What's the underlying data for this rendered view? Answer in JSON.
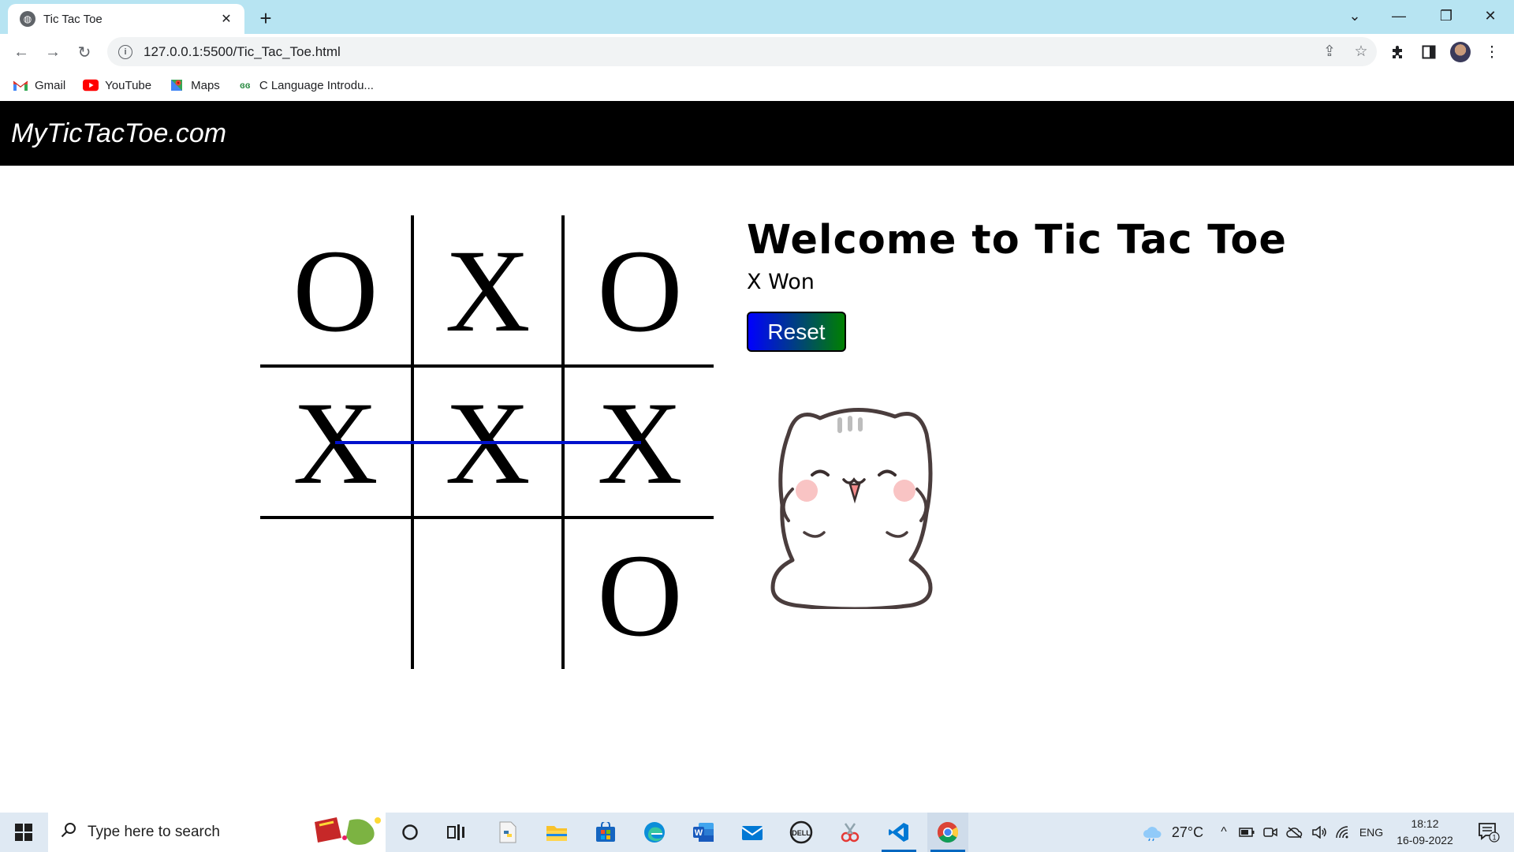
{
  "browser": {
    "tab_title": "Tic Tac Toe",
    "tab_close": "✕",
    "new_tab": "+",
    "url": "127.0.0.1:5500/Tic_Tac_Toe.html",
    "window_controls": {
      "dropdown": "⌄",
      "minimize": "—",
      "restore": "❐",
      "close": "✕"
    },
    "bookmarks": [
      {
        "label": "Gmail",
        "icon": "gmail-icon"
      },
      {
        "label": "YouTube",
        "icon": "youtube-icon"
      },
      {
        "label": "Maps",
        "icon": "maps-icon"
      },
      {
        "label": "C Language Introdu...",
        "icon": "geeksforgeeks-icon"
      }
    ]
  },
  "page": {
    "brand": "MyTicTacToe.com",
    "board": [
      "O",
      "X",
      "O",
      "X",
      "X",
      "X",
      "",
      "",
      "O"
    ],
    "winning_row": 2,
    "winline_color": "#0011cc",
    "heading": "Welcome to Tic Tac Toe",
    "status": "X Won",
    "reset_label": "Reset",
    "reset_gradient": [
      "#0000ff",
      "#008000"
    ]
  },
  "taskbar": {
    "search_placeholder": "Type here to search",
    "weather": "27°C",
    "language": "ENG",
    "time": "18:12",
    "date": "16-09-2022",
    "notification_count": "1"
  }
}
